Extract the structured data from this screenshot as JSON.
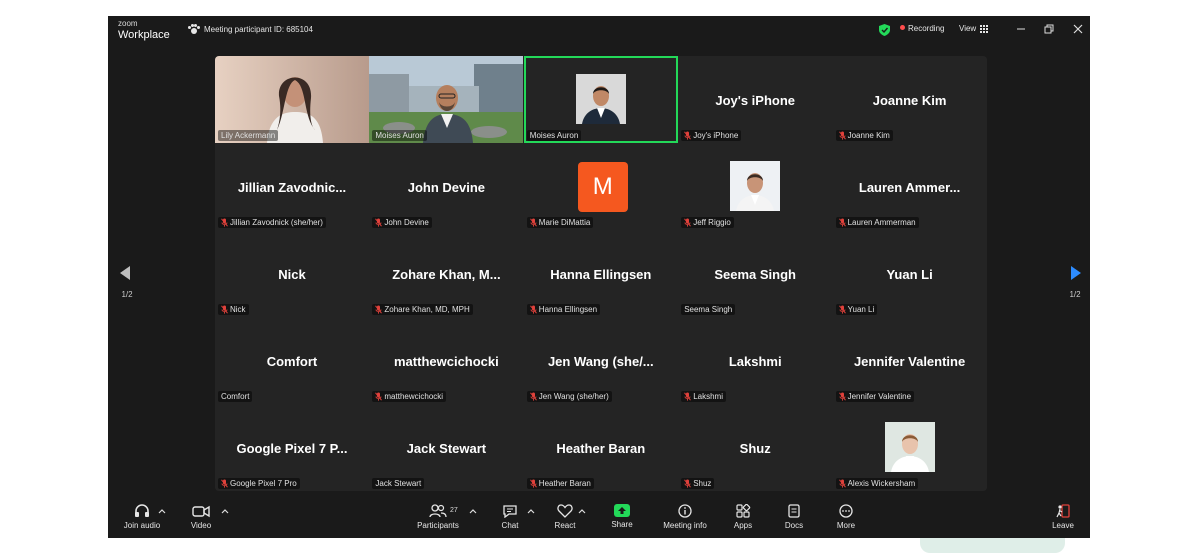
{
  "titlebar": {
    "logo_line1": "zoom",
    "logo_line2": "Workplace",
    "meeting_id": "Meeting participant ID: 685104",
    "recording": "Recording",
    "view": "View"
  },
  "tiles": [
    {
      "label": "Lily Ackermann",
      "big": "",
      "kind": "video1"
    },
    {
      "label": "Moises Auron",
      "big": "",
      "kind": "video2"
    },
    {
      "label": "Moises Auron",
      "big": "",
      "kind": "photo-man",
      "active": true
    },
    {
      "label": "Joy's iPhone",
      "big": "Joy's iPhone",
      "muted": true
    },
    {
      "label": "Joanne Kim",
      "big": "Joanne Kim",
      "muted": true
    },
    {
      "label": "Jillian Zavodnick (she/her)",
      "big": "Jillian  Zavodnic...",
      "muted": true
    },
    {
      "label": "John Devine",
      "big": "John Devine",
      "muted": true
    },
    {
      "label": "Marie DiMattia",
      "big": "",
      "kind": "avatar-m",
      "initial": "M",
      "muted": true
    },
    {
      "label": "Jeff Riggio",
      "big": "",
      "kind": "photo-man2",
      "muted": true
    },
    {
      "label": "Lauren Ammerman",
      "big": "Lauren  Ammer...",
      "muted": true
    },
    {
      "label": "Nick",
      "big": "Nick",
      "muted": true
    },
    {
      "label": "Zohare Khan, MD, MPH",
      "big": "Zohare  Khan,  M...",
      "muted": true
    },
    {
      "label": "Hanna Ellingsen",
      "big": "Hanna Ellingsen",
      "muted": true
    },
    {
      "label": "Seema Singh",
      "big": "Seema Singh",
      "muted": false
    },
    {
      "label": "Yuan Li",
      "big": "Yuan Li",
      "muted": true
    },
    {
      "label": "Comfort",
      "big": "Comfort",
      "muted": false
    },
    {
      "label": "matthewcichocki",
      "big": "matthewcichocki",
      "muted": true
    },
    {
      "label": "Jen Wang (she/her)",
      "big": "Jen  Wang  (she/...",
      "muted": true
    },
    {
      "label": "Lakshmi",
      "big": "Lakshmi",
      "muted": true
    },
    {
      "label": "Jennifer Valentine",
      "big": "Jennifer Valentine",
      "muted": true
    },
    {
      "label": "Google Pixel 7 Pro",
      "big": "Google  Pixel  7  P...",
      "muted": true
    },
    {
      "label": "Jack Stewart",
      "big": "Jack Stewart",
      "muted": false
    },
    {
      "label": "Heather Baran",
      "big": "Heather Baran",
      "muted": true
    },
    {
      "label": "Shuz",
      "big": "Shuz",
      "muted": true
    },
    {
      "label": "Alexis Wickersham",
      "big": "",
      "kind": "photo-woman",
      "muted": true
    }
  ],
  "pagination": {
    "left": "1/2",
    "right": "1/2"
  },
  "toolbar": {
    "join_audio": "Join audio",
    "video": "Video",
    "participants": "Participants",
    "participant_count": "27",
    "chat": "Chat",
    "react": "React",
    "share": "Share",
    "meeting_info": "Meeting info",
    "apps": "Apps",
    "docs": "Docs",
    "more": "More",
    "leave": "Leave"
  },
  "colors": {
    "active_border": "#23d959",
    "avatar_orange": "#f5581f",
    "muted_red": "#e0413b",
    "next_arrow": "#2d8cff"
  }
}
